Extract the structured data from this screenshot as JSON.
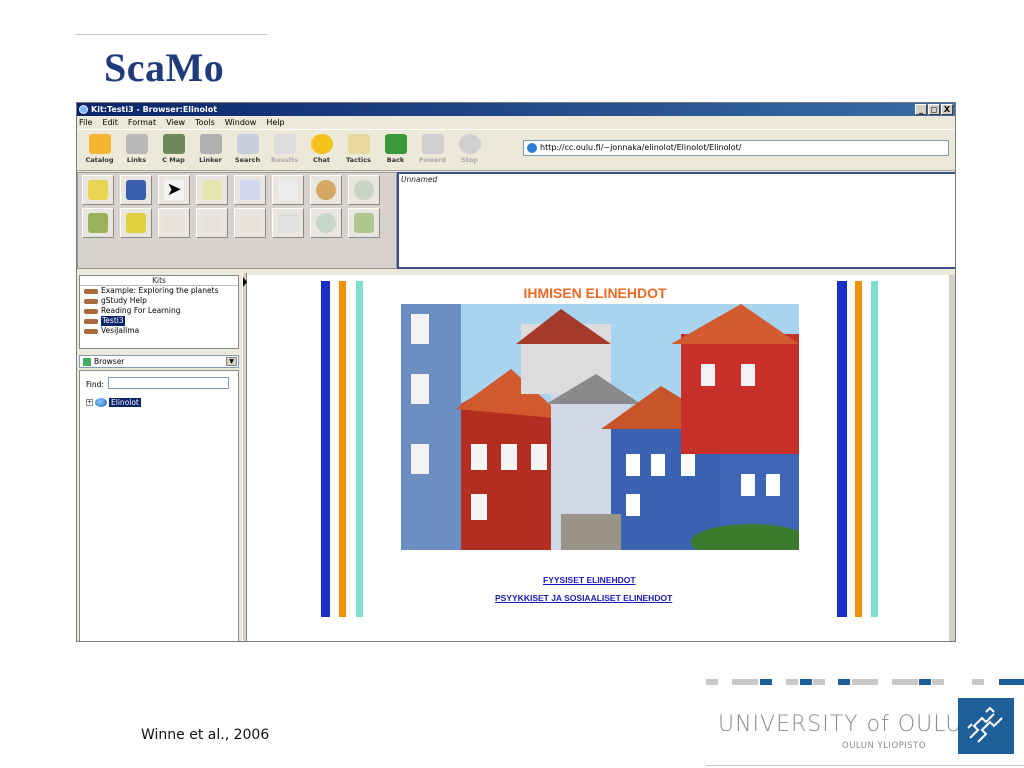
{
  "slide": {
    "title": "ScaMo",
    "citation": "Winne et al., 2006",
    "university": "UNIVERSITY",
    "university_of": "of",
    "university_city": "OULU",
    "university_sub": "OULUN YLIOPISTO"
  },
  "window": {
    "title": "Kit:Testi3 - Browser:Elinolot",
    "buttons": [
      "_",
      "×",
      "X"
    ]
  },
  "menu": [
    "File",
    "Edit",
    "Format",
    "View",
    "Tools",
    "Window",
    "Help"
  ],
  "toolbar": [
    {
      "label": "Catalog",
      "icon": "folder-icon",
      "color": "#f2b631"
    },
    {
      "label": "Links",
      "icon": "links-icon",
      "color": "#b8b8b8"
    },
    {
      "label": "C Map",
      "icon": "concept-map-icon",
      "color": "#6d8a5a"
    },
    {
      "label": "Linker",
      "icon": "linker-icon",
      "color": "#b0b0b0"
    },
    {
      "label": "Search",
      "icon": "magnifier-icon",
      "color": "#c5cfdc"
    },
    {
      "label": "Results",
      "icon": "results-icon",
      "color": "#c8c8c8",
      "disabled": true
    },
    {
      "label": "Chat",
      "icon": "chat-smiley-icon",
      "color": "#f4c21a"
    },
    {
      "label": "Tactics",
      "icon": "book-icon",
      "color": "#e9d9a0"
    },
    {
      "label": "Back",
      "icon": "back-arrow-icon",
      "color": "#3a9a3a"
    },
    {
      "label": "Foward",
      "icon": "forward-arrow-icon",
      "color": "#c0c0c0",
      "disabled": true
    },
    {
      "label": "Stop",
      "icon": "stop-icon",
      "color": "#c9c9c9",
      "disabled": true
    }
  ],
  "address": "http://cc.oulu.fi/~jonnaka/elinolot/Elinolot/Elinolot/",
  "map_caption": "Unnamed",
  "kits": {
    "header": "Kits",
    "items": [
      {
        "label": "Example: Exploring the planets",
        "selected": false
      },
      {
        "label": "gStudy Help",
        "selected": false
      },
      {
        "label": "Reading For Learning",
        "selected": false
      },
      {
        "label": "Testi3",
        "selected": true
      },
      {
        "label": "VesiJaIlma",
        "selected": false
      }
    ]
  },
  "browser_panel": {
    "selector": "Browser",
    "find_label": "Find:",
    "tree_item": "Elinolot"
  },
  "page": {
    "heading": "IHMISEN ELINEHDOT",
    "links": [
      "FYYSISET ELINEHDOT",
      "PSYYKKISET JA SOSIAALISET ELINEHDOT"
    ]
  },
  "colors": {
    "stripe_blue": "#1a2fc8",
    "stripe_orange": "#f39200",
    "stripe_aqua": "#7fe0d0",
    "title_blue": "#1f3b7a",
    "heading_orange": "#ee6a22"
  }
}
